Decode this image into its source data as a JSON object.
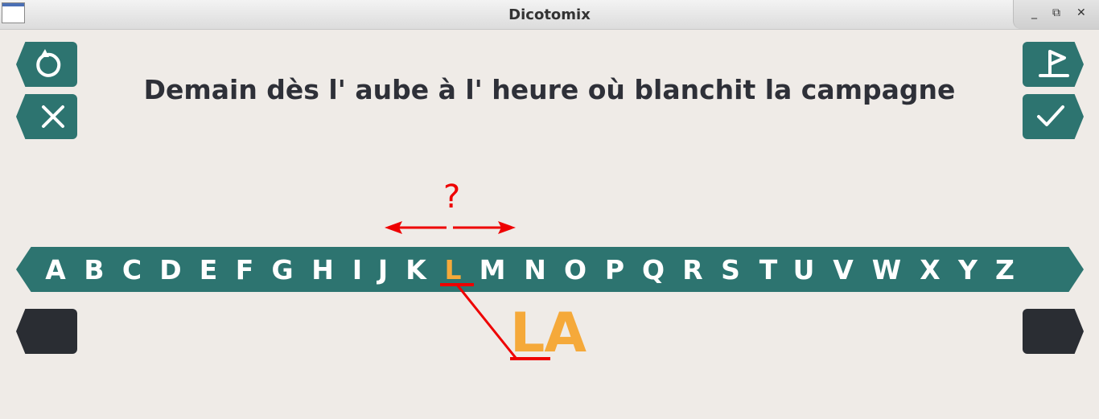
{
  "window": {
    "title": "Dicotomix",
    "controls": {
      "minimize": "_",
      "restore": "⧉",
      "close": "✕"
    }
  },
  "buttons": {
    "undo_icon": "undo-icon",
    "cancel_icon": "close-icon",
    "flag_icon": "flag-icon",
    "validate_icon": "check-icon"
  },
  "sentence": "Demain dès l' aube à l' heure où blanchit la campagne",
  "alphabet": [
    "A",
    "B",
    "C",
    "D",
    "E",
    "F",
    "G",
    "H",
    "I",
    "J",
    "K",
    "L",
    "M",
    "N",
    "O",
    "P",
    "Q",
    "R",
    "S",
    "T",
    "U",
    "V",
    "W",
    "X",
    "Y",
    "Z"
  ],
  "selected_letter": "L",
  "question_mark": "?",
  "current_word": "LA",
  "colors": {
    "accent": "#2d7470",
    "highlight": "#f5a93a",
    "annotation": "#ee0000",
    "dark_button": "#2a2d33",
    "background": "#efebe7"
  }
}
